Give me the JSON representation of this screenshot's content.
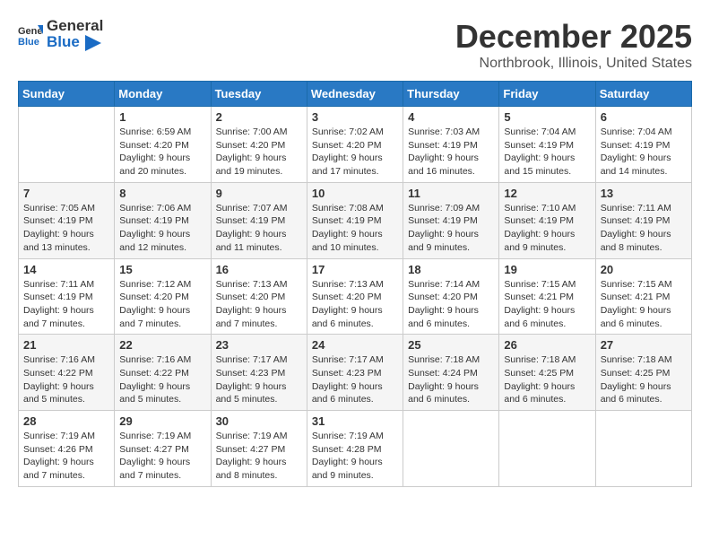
{
  "header": {
    "logo_general": "General",
    "logo_blue": "Blue",
    "title": "December 2025",
    "location": "Northbrook, Illinois, United States"
  },
  "days_of_week": [
    "Sunday",
    "Monday",
    "Tuesday",
    "Wednesday",
    "Thursday",
    "Friday",
    "Saturday"
  ],
  "weeks": [
    [
      {
        "num": "",
        "info": ""
      },
      {
        "num": "1",
        "info": "Sunrise: 6:59 AM\nSunset: 4:20 PM\nDaylight: 9 hours\nand 20 minutes."
      },
      {
        "num": "2",
        "info": "Sunrise: 7:00 AM\nSunset: 4:20 PM\nDaylight: 9 hours\nand 19 minutes."
      },
      {
        "num": "3",
        "info": "Sunrise: 7:02 AM\nSunset: 4:20 PM\nDaylight: 9 hours\nand 17 minutes."
      },
      {
        "num": "4",
        "info": "Sunrise: 7:03 AM\nSunset: 4:19 PM\nDaylight: 9 hours\nand 16 minutes."
      },
      {
        "num": "5",
        "info": "Sunrise: 7:04 AM\nSunset: 4:19 PM\nDaylight: 9 hours\nand 15 minutes."
      },
      {
        "num": "6",
        "info": "Sunrise: 7:04 AM\nSunset: 4:19 PM\nDaylight: 9 hours\nand 14 minutes."
      }
    ],
    [
      {
        "num": "7",
        "info": "Sunrise: 7:05 AM\nSunset: 4:19 PM\nDaylight: 9 hours\nand 13 minutes."
      },
      {
        "num": "8",
        "info": "Sunrise: 7:06 AM\nSunset: 4:19 PM\nDaylight: 9 hours\nand 12 minutes."
      },
      {
        "num": "9",
        "info": "Sunrise: 7:07 AM\nSunset: 4:19 PM\nDaylight: 9 hours\nand 11 minutes."
      },
      {
        "num": "10",
        "info": "Sunrise: 7:08 AM\nSunset: 4:19 PM\nDaylight: 9 hours\nand 10 minutes."
      },
      {
        "num": "11",
        "info": "Sunrise: 7:09 AM\nSunset: 4:19 PM\nDaylight: 9 hours\nand 9 minutes."
      },
      {
        "num": "12",
        "info": "Sunrise: 7:10 AM\nSunset: 4:19 PM\nDaylight: 9 hours\nand 9 minutes."
      },
      {
        "num": "13",
        "info": "Sunrise: 7:11 AM\nSunset: 4:19 PM\nDaylight: 9 hours\nand 8 minutes."
      }
    ],
    [
      {
        "num": "14",
        "info": "Sunrise: 7:11 AM\nSunset: 4:19 PM\nDaylight: 9 hours\nand 7 minutes."
      },
      {
        "num": "15",
        "info": "Sunrise: 7:12 AM\nSunset: 4:20 PM\nDaylight: 9 hours\nand 7 minutes."
      },
      {
        "num": "16",
        "info": "Sunrise: 7:13 AM\nSunset: 4:20 PM\nDaylight: 9 hours\nand 7 minutes."
      },
      {
        "num": "17",
        "info": "Sunrise: 7:13 AM\nSunset: 4:20 PM\nDaylight: 9 hours\nand 6 minutes."
      },
      {
        "num": "18",
        "info": "Sunrise: 7:14 AM\nSunset: 4:20 PM\nDaylight: 9 hours\nand 6 minutes."
      },
      {
        "num": "19",
        "info": "Sunrise: 7:15 AM\nSunset: 4:21 PM\nDaylight: 9 hours\nand 6 minutes."
      },
      {
        "num": "20",
        "info": "Sunrise: 7:15 AM\nSunset: 4:21 PM\nDaylight: 9 hours\nand 6 minutes."
      }
    ],
    [
      {
        "num": "21",
        "info": "Sunrise: 7:16 AM\nSunset: 4:22 PM\nDaylight: 9 hours\nand 5 minutes."
      },
      {
        "num": "22",
        "info": "Sunrise: 7:16 AM\nSunset: 4:22 PM\nDaylight: 9 hours\nand 5 minutes."
      },
      {
        "num": "23",
        "info": "Sunrise: 7:17 AM\nSunset: 4:23 PM\nDaylight: 9 hours\nand 5 minutes."
      },
      {
        "num": "24",
        "info": "Sunrise: 7:17 AM\nSunset: 4:23 PM\nDaylight: 9 hours\nand 6 minutes."
      },
      {
        "num": "25",
        "info": "Sunrise: 7:18 AM\nSunset: 4:24 PM\nDaylight: 9 hours\nand 6 minutes."
      },
      {
        "num": "26",
        "info": "Sunrise: 7:18 AM\nSunset: 4:25 PM\nDaylight: 9 hours\nand 6 minutes."
      },
      {
        "num": "27",
        "info": "Sunrise: 7:18 AM\nSunset: 4:25 PM\nDaylight: 9 hours\nand 6 minutes."
      }
    ],
    [
      {
        "num": "28",
        "info": "Sunrise: 7:19 AM\nSunset: 4:26 PM\nDaylight: 9 hours\nand 7 minutes."
      },
      {
        "num": "29",
        "info": "Sunrise: 7:19 AM\nSunset: 4:27 PM\nDaylight: 9 hours\nand 7 minutes."
      },
      {
        "num": "30",
        "info": "Sunrise: 7:19 AM\nSunset: 4:27 PM\nDaylight: 9 hours\nand 8 minutes."
      },
      {
        "num": "31",
        "info": "Sunrise: 7:19 AM\nSunset: 4:28 PM\nDaylight: 9 hours\nand 9 minutes."
      },
      {
        "num": "",
        "info": ""
      },
      {
        "num": "",
        "info": ""
      },
      {
        "num": "",
        "info": ""
      }
    ]
  ]
}
